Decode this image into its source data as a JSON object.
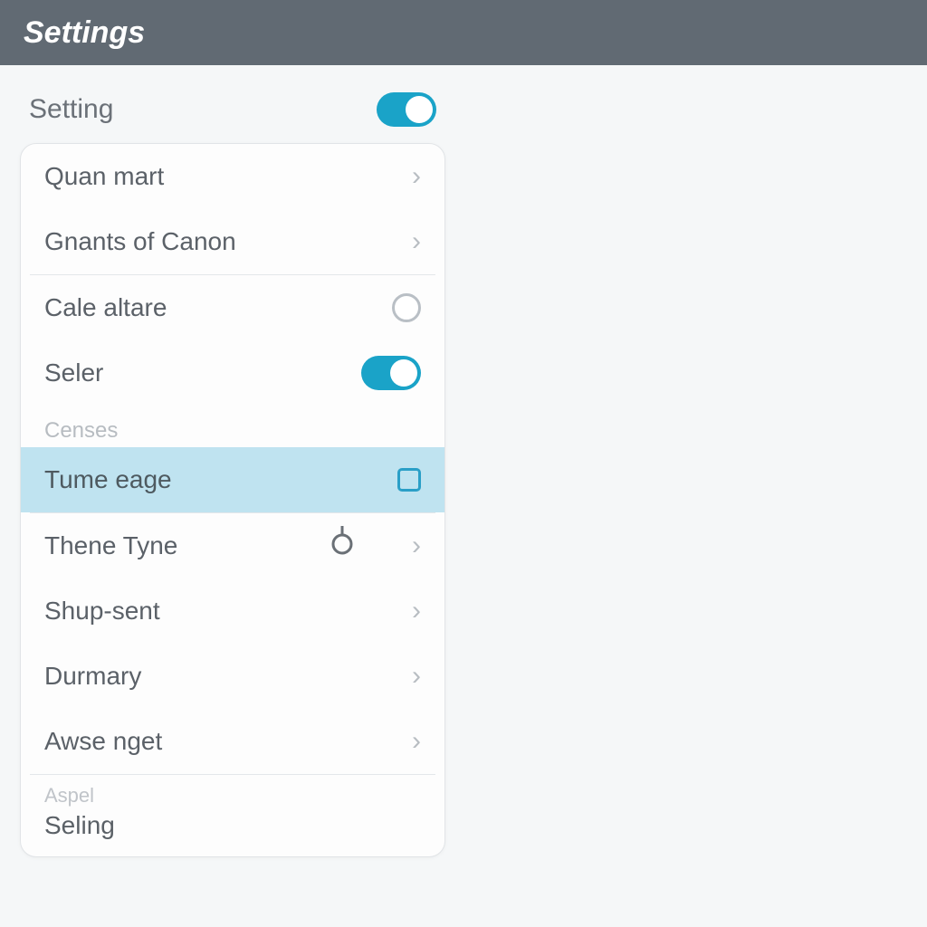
{
  "title": "Settings",
  "top": {
    "label": "Setting",
    "toggle_on": true
  },
  "group1": {
    "items": [
      {
        "label": "Quan mart"
      },
      {
        "label": "Gnants of Canon"
      }
    ]
  },
  "group2": {
    "cale": {
      "label": "Cale altare"
    },
    "seler": {
      "label": "Seler",
      "toggle_on": true
    },
    "section": "Censes",
    "selected": {
      "label": "Tume eage"
    }
  },
  "group3": {
    "items": [
      {
        "label": "Thene Tyne"
      },
      {
        "label": "Shup-sent"
      },
      {
        "label": "Durmary"
      },
      {
        "label": "Awse nget"
      }
    ]
  },
  "footer": {
    "small": "Aspel",
    "big": "Seling"
  },
  "colors": {
    "accent": "#1aa3c8",
    "highlight": "#bfe3f0",
    "titlebar": "#616a73"
  }
}
